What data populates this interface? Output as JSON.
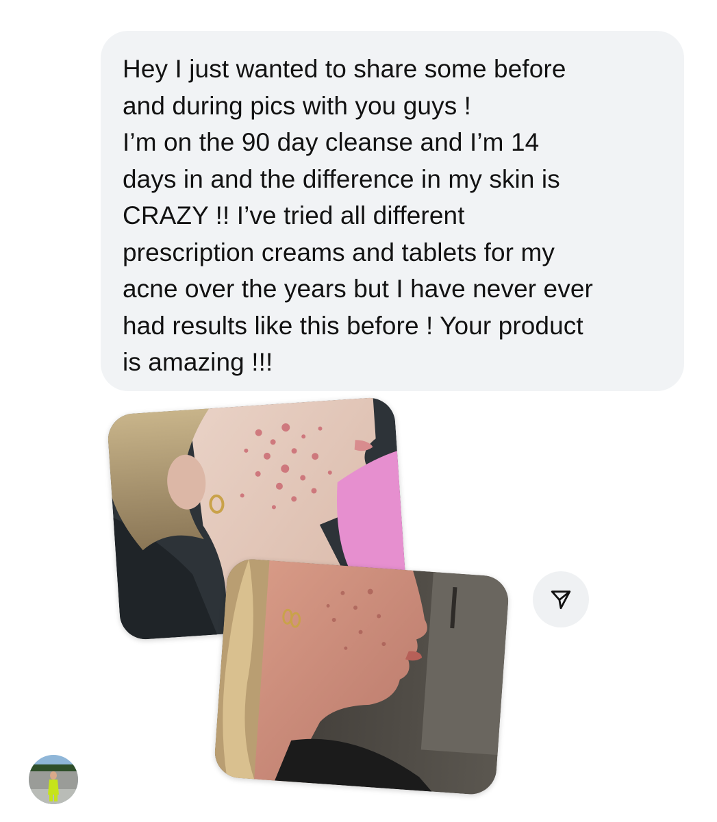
{
  "message": {
    "lines": [
      "Hey I just wanted to share some before",
      "and during pics with you guys !",
      "I’m on the 90 day cleanse and I’m 14",
      "days in and the difference in my skin is",
      "CRAZY !! I’ve tried all different",
      "prescription creams and tablets for my",
      "acne over the years but I have never ever",
      "had results like this before ! Your product",
      "is amazing !!!"
    ]
  },
  "share": {
    "icon": "paper-plane-icon"
  },
  "colors": {
    "bubble_background": "#f1f3f5",
    "text": "#121212",
    "share_button_background": "#eff1f3"
  }
}
